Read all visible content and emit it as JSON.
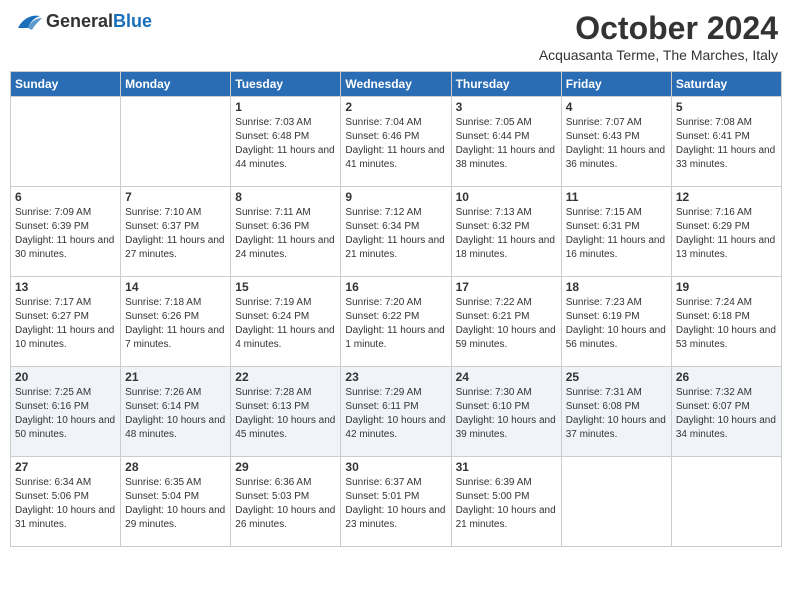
{
  "header": {
    "logo_general": "General",
    "logo_blue": "Blue",
    "month_title": "October 2024",
    "location": "Acquasanta Terme, The Marches, Italy"
  },
  "weekdays": [
    "Sunday",
    "Monday",
    "Tuesday",
    "Wednesday",
    "Thursday",
    "Friday",
    "Saturday"
  ],
  "weeks": [
    [
      {
        "day": "",
        "sunrise": "",
        "sunset": "",
        "daylight": ""
      },
      {
        "day": "",
        "sunrise": "",
        "sunset": "",
        "daylight": ""
      },
      {
        "day": "1",
        "sunrise": "Sunrise: 7:03 AM",
        "sunset": "Sunset: 6:48 PM",
        "daylight": "Daylight: 11 hours and 44 minutes."
      },
      {
        "day": "2",
        "sunrise": "Sunrise: 7:04 AM",
        "sunset": "Sunset: 6:46 PM",
        "daylight": "Daylight: 11 hours and 41 minutes."
      },
      {
        "day": "3",
        "sunrise": "Sunrise: 7:05 AM",
        "sunset": "Sunset: 6:44 PM",
        "daylight": "Daylight: 11 hours and 38 minutes."
      },
      {
        "day": "4",
        "sunrise": "Sunrise: 7:07 AM",
        "sunset": "Sunset: 6:43 PM",
        "daylight": "Daylight: 11 hours and 36 minutes."
      },
      {
        "day": "5",
        "sunrise": "Sunrise: 7:08 AM",
        "sunset": "Sunset: 6:41 PM",
        "daylight": "Daylight: 11 hours and 33 minutes."
      }
    ],
    [
      {
        "day": "6",
        "sunrise": "Sunrise: 7:09 AM",
        "sunset": "Sunset: 6:39 PM",
        "daylight": "Daylight: 11 hours and 30 minutes."
      },
      {
        "day": "7",
        "sunrise": "Sunrise: 7:10 AM",
        "sunset": "Sunset: 6:37 PM",
        "daylight": "Daylight: 11 hours and 27 minutes."
      },
      {
        "day": "8",
        "sunrise": "Sunrise: 7:11 AM",
        "sunset": "Sunset: 6:36 PM",
        "daylight": "Daylight: 11 hours and 24 minutes."
      },
      {
        "day": "9",
        "sunrise": "Sunrise: 7:12 AM",
        "sunset": "Sunset: 6:34 PM",
        "daylight": "Daylight: 11 hours and 21 minutes."
      },
      {
        "day": "10",
        "sunrise": "Sunrise: 7:13 AM",
        "sunset": "Sunset: 6:32 PM",
        "daylight": "Daylight: 11 hours and 18 minutes."
      },
      {
        "day": "11",
        "sunrise": "Sunrise: 7:15 AM",
        "sunset": "Sunset: 6:31 PM",
        "daylight": "Daylight: 11 hours and 16 minutes."
      },
      {
        "day": "12",
        "sunrise": "Sunrise: 7:16 AM",
        "sunset": "Sunset: 6:29 PM",
        "daylight": "Daylight: 11 hours and 13 minutes."
      }
    ],
    [
      {
        "day": "13",
        "sunrise": "Sunrise: 7:17 AM",
        "sunset": "Sunset: 6:27 PM",
        "daylight": "Daylight: 11 hours and 10 minutes."
      },
      {
        "day": "14",
        "sunrise": "Sunrise: 7:18 AM",
        "sunset": "Sunset: 6:26 PM",
        "daylight": "Daylight: 11 hours and 7 minutes."
      },
      {
        "day": "15",
        "sunrise": "Sunrise: 7:19 AM",
        "sunset": "Sunset: 6:24 PM",
        "daylight": "Daylight: 11 hours and 4 minutes."
      },
      {
        "day": "16",
        "sunrise": "Sunrise: 7:20 AM",
        "sunset": "Sunset: 6:22 PM",
        "daylight": "Daylight: 11 hours and 1 minute."
      },
      {
        "day": "17",
        "sunrise": "Sunrise: 7:22 AM",
        "sunset": "Sunset: 6:21 PM",
        "daylight": "Daylight: 10 hours and 59 minutes."
      },
      {
        "day": "18",
        "sunrise": "Sunrise: 7:23 AM",
        "sunset": "Sunset: 6:19 PM",
        "daylight": "Daylight: 10 hours and 56 minutes."
      },
      {
        "day": "19",
        "sunrise": "Sunrise: 7:24 AM",
        "sunset": "Sunset: 6:18 PM",
        "daylight": "Daylight: 10 hours and 53 minutes."
      }
    ],
    [
      {
        "day": "20",
        "sunrise": "Sunrise: 7:25 AM",
        "sunset": "Sunset: 6:16 PM",
        "daylight": "Daylight: 10 hours and 50 minutes."
      },
      {
        "day": "21",
        "sunrise": "Sunrise: 7:26 AM",
        "sunset": "Sunset: 6:14 PM",
        "daylight": "Daylight: 10 hours and 48 minutes."
      },
      {
        "day": "22",
        "sunrise": "Sunrise: 7:28 AM",
        "sunset": "Sunset: 6:13 PM",
        "daylight": "Daylight: 10 hours and 45 minutes."
      },
      {
        "day": "23",
        "sunrise": "Sunrise: 7:29 AM",
        "sunset": "Sunset: 6:11 PM",
        "daylight": "Daylight: 10 hours and 42 minutes."
      },
      {
        "day": "24",
        "sunrise": "Sunrise: 7:30 AM",
        "sunset": "Sunset: 6:10 PM",
        "daylight": "Daylight: 10 hours and 39 minutes."
      },
      {
        "day": "25",
        "sunrise": "Sunrise: 7:31 AM",
        "sunset": "Sunset: 6:08 PM",
        "daylight": "Daylight: 10 hours and 37 minutes."
      },
      {
        "day": "26",
        "sunrise": "Sunrise: 7:32 AM",
        "sunset": "Sunset: 6:07 PM",
        "daylight": "Daylight: 10 hours and 34 minutes."
      }
    ],
    [
      {
        "day": "27",
        "sunrise": "Sunrise: 6:34 AM",
        "sunset": "Sunset: 5:06 PM",
        "daylight": "Daylight: 10 hours and 31 minutes."
      },
      {
        "day": "28",
        "sunrise": "Sunrise: 6:35 AM",
        "sunset": "Sunset: 5:04 PM",
        "daylight": "Daylight: 10 hours and 29 minutes."
      },
      {
        "day": "29",
        "sunrise": "Sunrise: 6:36 AM",
        "sunset": "Sunset: 5:03 PM",
        "daylight": "Daylight: 10 hours and 26 minutes."
      },
      {
        "day": "30",
        "sunrise": "Sunrise: 6:37 AM",
        "sunset": "Sunset: 5:01 PM",
        "daylight": "Daylight: 10 hours and 23 minutes."
      },
      {
        "day": "31",
        "sunrise": "Sunrise: 6:39 AM",
        "sunset": "Sunset: 5:00 PM",
        "daylight": "Daylight: 10 hours and 21 minutes."
      },
      {
        "day": "",
        "sunrise": "",
        "sunset": "",
        "daylight": ""
      },
      {
        "day": "",
        "sunrise": "",
        "sunset": "",
        "daylight": ""
      }
    ]
  ]
}
